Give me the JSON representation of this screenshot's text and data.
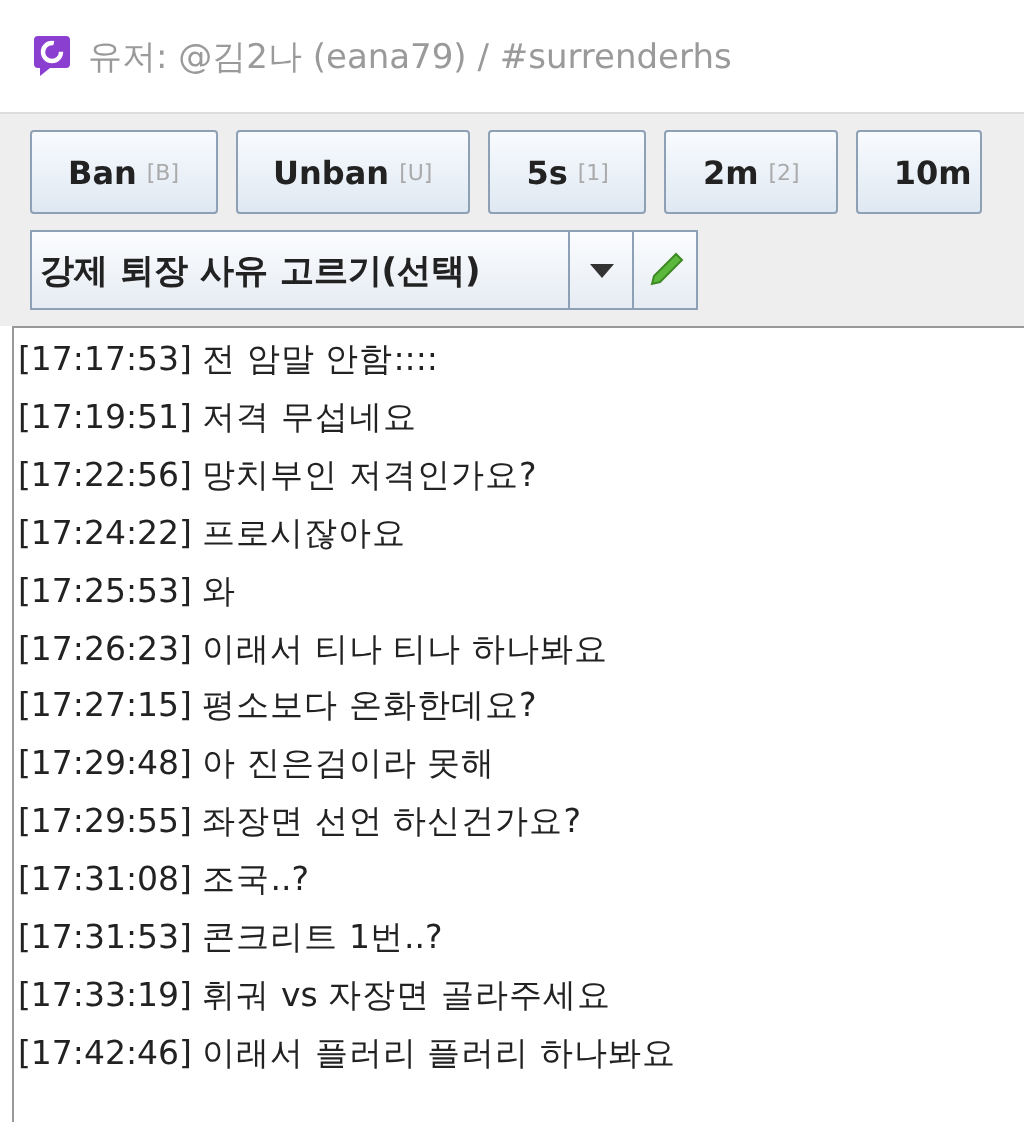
{
  "window": {
    "title": "유저: @김2나 (eana79) / #surrenderhs"
  },
  "buttons": [
    {
      "label": "Ban",
      "key": "[B]"
    },
    {
      "label": "Unban",
      "key": "[U]"
    },
    {
      "label": "5s",
      "key": "[1]"
    },
    {
      "label": "2m",
      "key": "[2]"
    },
    {
      "label": "10m"
    }
  ],
  "reason_select": {
    "value": "강제 퇴장 사유 고르기(선택)"
  },
  "messages": [
    {
      "time": "[17:17:53]",
      "text": "전 암말 안함::::"
    },
    {
      "time": "[17:19:51]",
      "text": "저격 무섭네요"
    },
    {
      "time": "[17:22:56]",
      "text": "망치부인 저격인가요?"
    },
    {
      "time": "[17:24:22]",
      "text": "프로시잖아요"
    },
    {
      "time": "[17:25:53]",
      "text": "와"
    },
    {
      "time": "[17:26:23]",
      "text": "이래서 티나 티나 하나봐요"
    },
    {
      "time": "[17:27:15]",
      "text": "평소보다 온화한데요?"
    },
    {
      "time": "[17:29:48]",
      "text": "아 진은검이라 못해"
    },
    {
      "time": "[17:29:55]",
      "text": "좌장면 선언 하신건가요?"
    },
    {
      "time": "[17:31:08]",
      "text": "조국..?"
    },
    {
      "time": "[17:31:53]",
      "text": "콘크리트 1번..?"
    },
    {
      "time": "[17:33:19]",
      "text": "휘궈 vs 자장면 골라주세요"
    },
    {
      "time": "[17:42:46]",
      "text": "이래서 플러리 플러리 하나봐요"
    }
  ]
}
